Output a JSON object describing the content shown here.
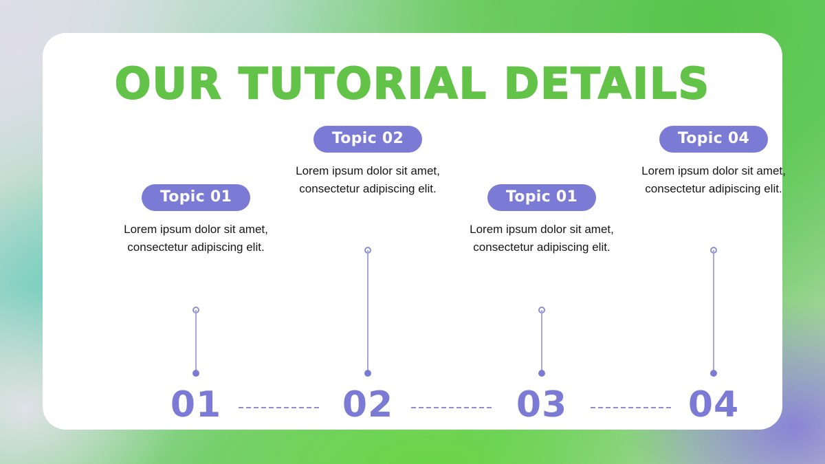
{
  "slide": {
    "title": "OUR TUTORIAL DETAILS",
    "title_color": "#63c348",
    "accent_color": "#7b7bd6",
    "card_color": "#ffffff"
  },
  "topics": [
    {
      "badge": "Topic 01",
      "description": "Lorem ipsum dolor sit amet, consectetur adipiscing elit.",
      "step": "01"
    },
    {
      "badge": "Topic 02",
      "description": "Lorem ipsum dolor sit amet, consectetur adipiscing elit.",
      "step": "02"
    },
    {
      "badge": "Topic 01",
      "description": "Lorem ipsum dolor sit amet, consectetur adipiscing elit.",
      "step": "03"
    },
    {
      "badge": "Topic 04",
      "description": "Lorem ipsum dolor sit amet, consectetur adipiscing elit.",
      "step": "04"
    }
  ]
}
